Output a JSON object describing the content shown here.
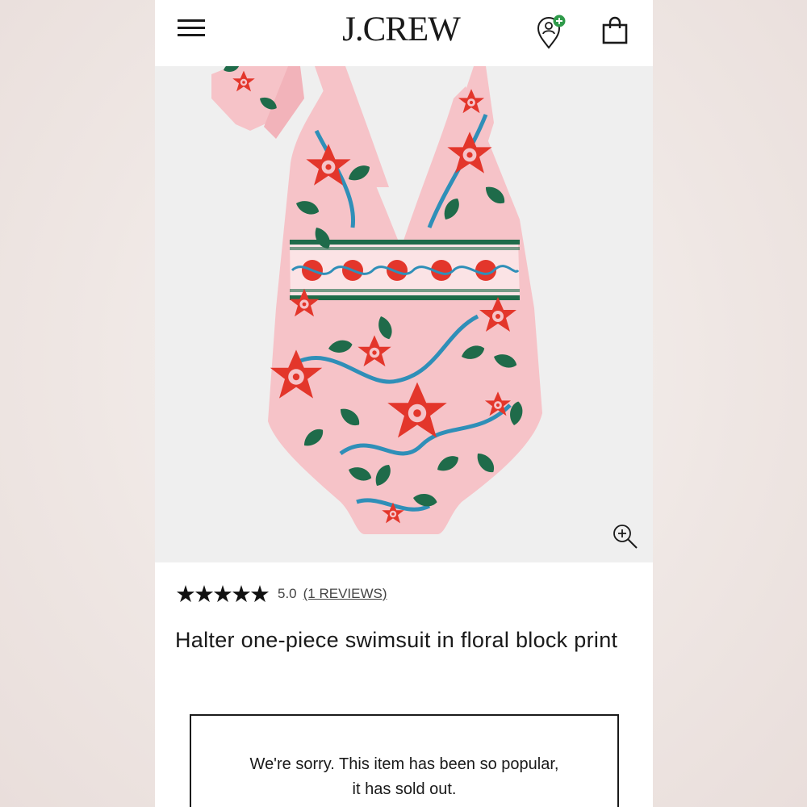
{
  "header": {
    "brand": "J.CREW",
    "menu_icon": "hamburger-menu-icon",
    "account_icon": "account-add-icon",
    "bag_icon": "shopping-bag-icon"
  },
  "product": {
    "image_icon": "zoom-in-icon",
    "stars": "★★★★★",
    "rating": "5.0",
    "reviews_link": "(1 REVIEWS)",
    "title": "Halter one-piece swimsuit in floral block print",
    "sold_out_line1": "We're sorry. This item has been so popular,",
    "sold_out_line2": "it has sold out."
  },
  "colors": {
    "swimsuit_pink": "#f6c3c8",
    "flower_red": "#e3362b",
    "leaf_green": "#1f6b4a",
    "vine_blue": "#2f8fb8",
    "account_badge_green": "#2f9a4a"
  }
}
